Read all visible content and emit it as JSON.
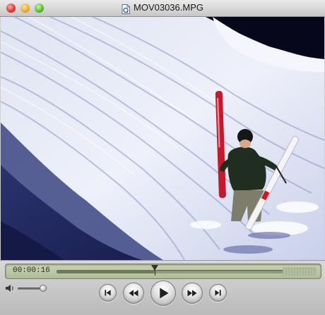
{
  "window": {
    "title": "MOV03036.MPG",
    "traffic_lights": [
      "close",
      "minimize",
      "zoom"
    ],
    "file_icon": "quicktime-file-icon"
  },
  "video": {
    "scene": "skier-climbing-snowy-slope"
  },
  "controller": {
    "current_time": "00:00:16",
    "playback_progress": 0.43,
    "volume_level": 0.9,
    "buttons": [
      "skip-to-start",
      "rewind",
      "play",
      "fast-forward",
      "skip-to-end"
    ]
  },
  "colors": {
    "lcd_background": "#b9c5a3",
    "title_bar": "#d6d6d6",
    "sky": "#0a0a24",
    "snow": "#ecf0fb"
  }
}
